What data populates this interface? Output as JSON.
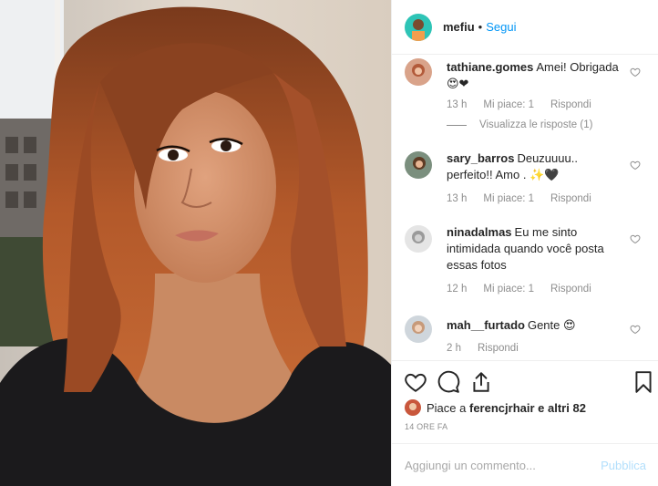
{
  "post": {
    "photo_alt": "selfie"
  },
  "header": {
    "username": "mefiu",
    "separator": "•",
    "follow_label": "Segui"
  },
  "comments": [
    {
      "username": "tathiane.gomes",
      "text": "Amei! Obrigada 😍❤",
      "time": "13 h",
      "likes": "Mi piace: 1",
      "reply_label": "Rispondi",
      "view_replies": "Visualizza le risposte (1)"
    },
    {
      "username": "sary_barros",
      "text": "Deuzuuuu.. perfeito!! Amo . ✨🖤",
      "time": "13 h",
      "likes": "Mi piace: 1",
      "reply_label": "Rispondi"
    },
    {
      "username": "ninadalmas",
      "text": "Eu me sinto intimidada quando você posta essas fotos",
      "time": "12 h",
      "likes": "Mi piace: 1",
      "reply_label": "Rispondi"
    },
    {
      "username": "mah__furtado",
      "text": "Gente 😍",
      "time": "2 h",
      "reply_label": "Rispondi"
    }
  ],
  "likes_line": {
    "prefix": "Piace a",
    "user": "ferencjrhair",
    "suffix": "e altri 82"
  },
  "timestamp": "14 ORE FA",
  "add_comment": {
    "placeholder": "Aggiungi un commento...",
    "post_label": "Pubblica"
  },
  "icons": {
    "like": "heart-icon",
    "comment": "comment-bubble-icon",
    "share": "share-icon",
    "save": "bookmark-icon"
  }
}
